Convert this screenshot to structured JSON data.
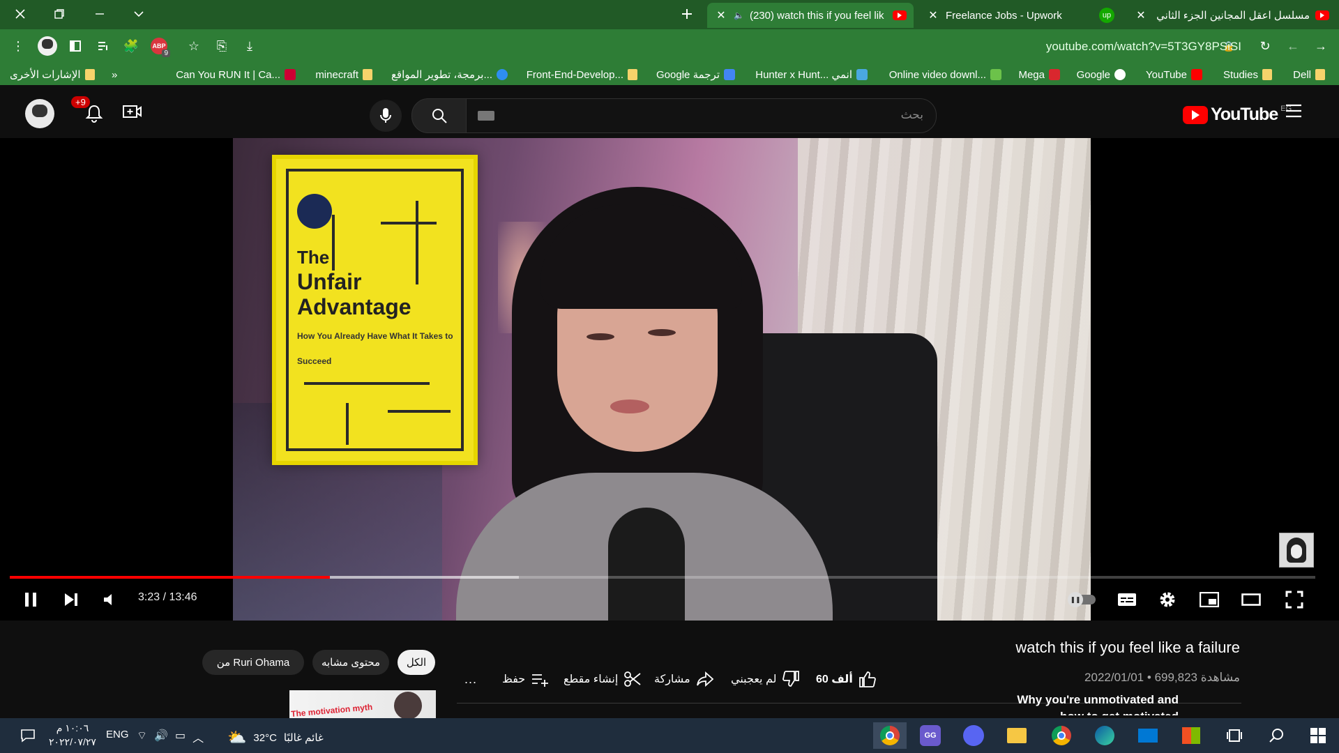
{
  "browser": {
    "tabs": [
      {
        "title": "(230) watch this if you feel lik",
        "active": true
      },
      {
        "title": "Freelance Jobs - Upwork",
        "active": false
      },
      {
        "title": "مسلسل اعقل المجانين الجزء الثاني",
        "active": false
      }
    ],
    "url": "youtube.com/watch?v=5T3GY8PSiSI",
    "extension_badge": "9",
    "colors": {
      "frame": "#215a26",
      "toolbar": "#2e7d36"
    }
  },
  "bookmarks": [
    {
      "label": "Dell",
      "icon": "folder-icon"
    },
    {
      "label": "Studies",
      "icon": "folder-icon"
    },
    {
      "label": "YouTube",
      "icon": "youtube-icon"
    },
    {
      "label": "Google",
      "icon": "google-icon"
    },
    {
      "label": "Mega",
      "icon": "mega-icon"
    },
    {
      "label": "Online video downl...",
      "icon": "download-icon"
    },
    {
      "label": "Hunter x Hunt... انمي",
      "icon": "w-icon"
    },
    {
      "label": "Google ترجمة",
      "icon": "translate-icon"
    },
    {
      "label": "Front-End-Develop...",
      "icon": "folder-icon"
    },
    {
      "label": "برمجة، تطوير المواقع...",
      "icon": "circle-icon"
    },
    {
      "label": "minecraft",
      "icon": "folder-icon"
    },
    {
      "label": "Can You RUN It | Ca...",
      "icon": "canyourunit-icon"
    },
    {
      "label": "»",
      "icon": ""
    },
    {
      "label": "الإشارات الأخرى",
      "icon": "folder-icon"
    }
  ],
  "youtube": {
    "logo_text": "YouTube",
    "region": "EG",
    "search_placeholder": "بحث",
    "notification_count": "+9",
    "colors": {
      "accent": "#ff0000"
    }
  },
  "player": {
    "time": "3:23 / 13:46",
    "played_fraction": 0.245,
    "buffered_fraction": 0.39,
    "book": {
      "line1": "The",
      "line2": "Unfair",
      "line3": "Advantage",
      "line4": "How You Already Have What It Takes to Succeed"
    }
  },
  "video": {
    "title": "watch this if you feel like a failure",
    "views": "699,823 مشاهدة",
    "date": "2022/01/01",
    "meta_separator": "•",
    "likes": "60 ألف",
    "dislike_label": "لم يعجبني",
    "share_label": "مشاركة",
    "clip_label": "إنشاء مقطع",
    "save_label": "حفظ",
    "more_label": "..."
  },
  "chips": [
    {
      "label": "الكل",
      "selected": true
    },
    {
      "label": "محتوى مشابه",
      "selected": false
    },
    {
      "label": "من Ruri Ohama",
      "selected": false
    }
  ],
  "recommendation": {
    "title_line1": "Why you're unmotivated and",
    "title_line2": "how to get motivated",
    "thumb_text": "The motivation myth"
  },
  "taskbar": {
    "weather_text": "غائم غالبًا",
    "temperature": "32°C",
    "language": "ENG",
    "time": "١٠:٠٦ م",
    "date": "٢٠٢٢/٠٧/٢٧"
  }
}
